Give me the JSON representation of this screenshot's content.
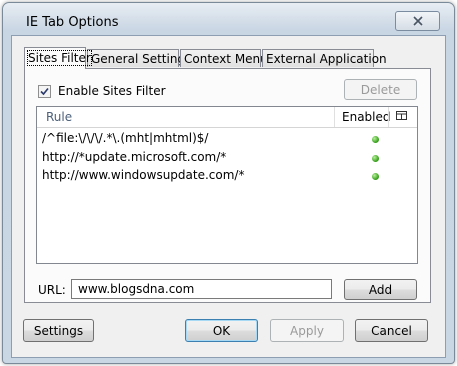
{
  "window": {
    "title": "IE Tab Options",
    "close_label": "✕"
  },
  "tabs": [
    {
      "label": "Sites Filter",
      "active": true
    },
    {
      "label": "General Settings",
      "active": false
    },
    {
      "label": "Context Menu",
      "active": false
    },
    {
      "label": "External Application",
      "active": false
    }
  ],
  "sites_filter": {
    "enable_label": "Enable Sites Filter",
    "enable_checked": true,
    "delete_label": "Delete",
    "columns": {
      "rule": "Rule",
      "enabled": "Enabled"
    },
    "rules": [
      {
        "rule": "/^file:\\/\\/\\/.*\\.(mht|mhtml)$/",
        "enabled": true
      },
      {
        "rule": "http://*update.microsoft.com/*",
        "enabled": true
      },
      {
        "rule": "http://www.windowsupdate.com/*",
        "enabled": true
      }
    ],
    "url_label": "URL:",
    "url_value": "www.blogsdna.com",
    "add_label": "Add"
  },
  "footer": {
    "settings_label": "Settings",
    "ok_label": "OK",
    "apply_label": "Apply",
    "cancel_label": "Cancel"
  },
  "colors": {
    "enabled_dot": "#2f9a14",
    "title_bar": "#c8d5e3"
  }
}
